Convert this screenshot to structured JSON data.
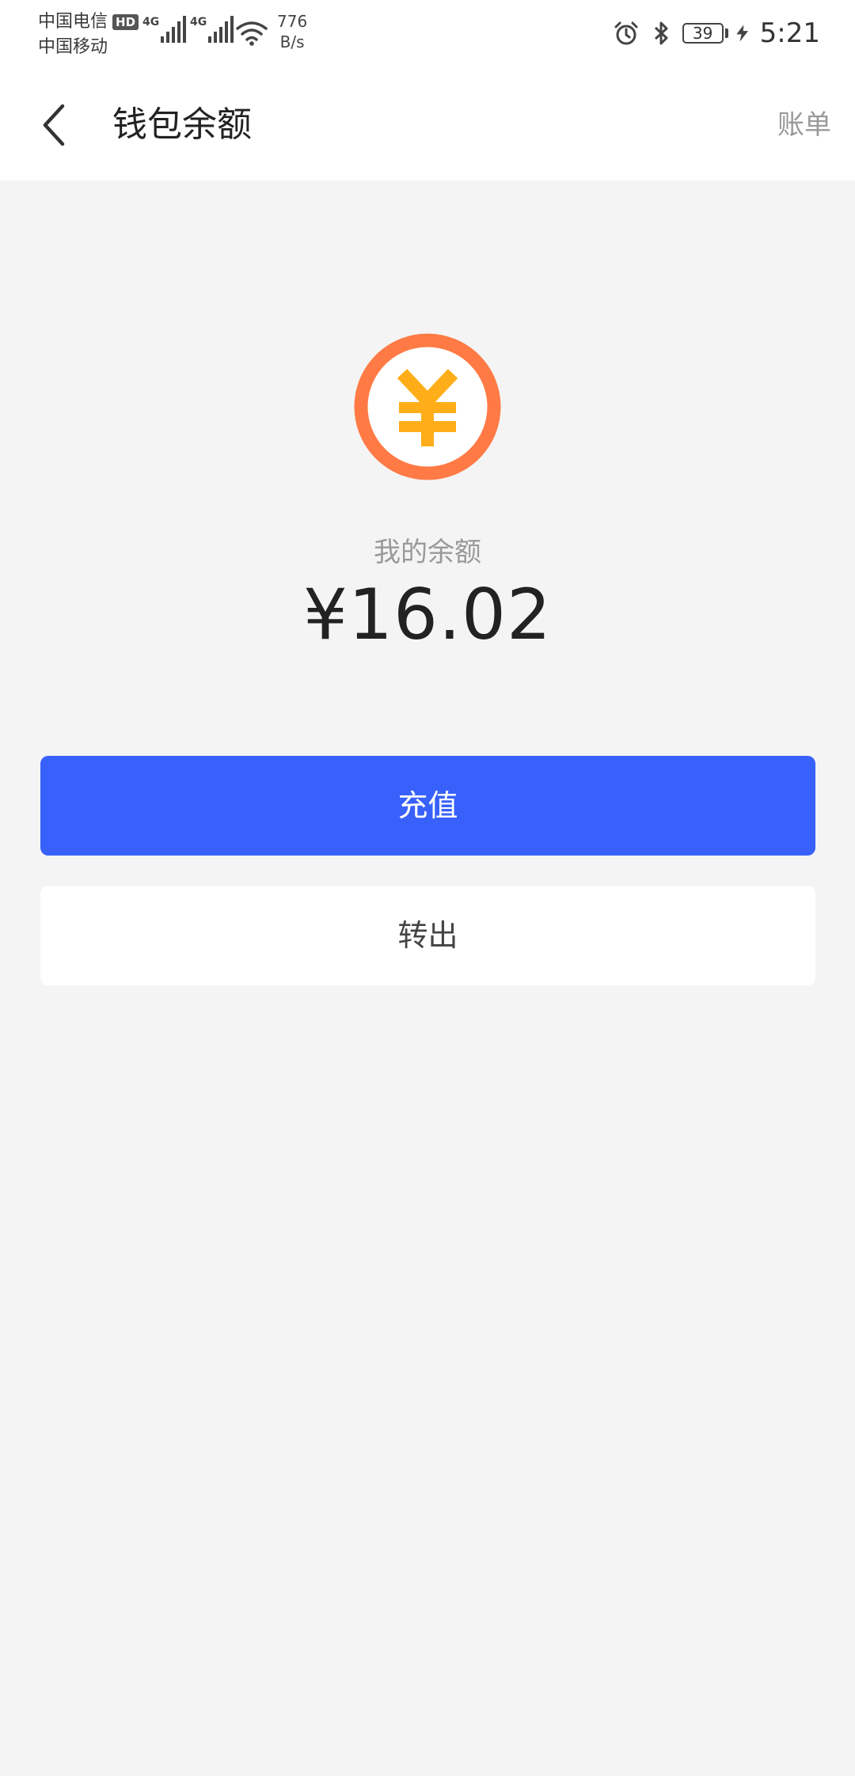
{
  "status_bar": {
    "carrier_1": "中国电信",
    "carrier_1_badge": "HD",
    "carrier_2": "中国移动",
    "network_1": "4G",
    "network_2": "4G",
    "speed_value": "776",
    "speed_unit": "B/s",
    "battery_level": "39",
    "time": "5:21"
  },
  "header": {
    "title": "钱包余额",
    "bill_link": "账单"
  },
  "balance": {
    "label": "我的余额",
    "amount": "¥16.02"
  },
  "actions": {
    "recharge_label": "充值",
    "withdraw_label": "转出"
  },
  "colors": {
    "primary": "#3861fb",
    "coin_ring": "#ff7a45",
    "coin_symbol": "#ffae1a"
  },
  "icons": {
    "back": "chevron-left-icon",
    "coin": "yuan-coin-icon"
  }
}
